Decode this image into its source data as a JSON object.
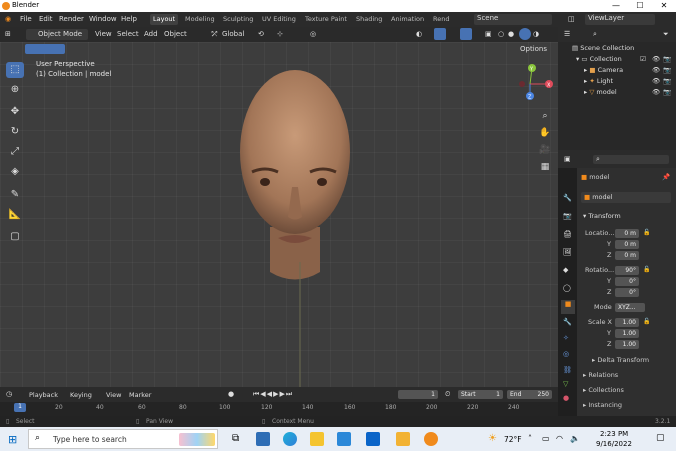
{
  "window": {
    "title": "Blender",
    "minimize": "—",
    "maximize": "☐",
    "close": "✕"
  },
  "menu": [
    "File",
    "Edit",
    "Render",
    "Window",
    "Help"
  ],
  "workspaces": [
    "Layout",
    "Modeling",
    "Sculpting",
    "UV Editing",
    "Texture Paint",
    "Shading",
    "Animation",
    "Rend"
  ],
  "scene": "Scene",
  "view_layer": "ViewLayer",
  "viewport": {
    "mode": "Object Mode",
    "menus": [
      "View",
      "Select",
      "Add",
      "Object"
    ],
    "orientation": "Global",
    "options": "Options",
    "overlay_title": "User Perspective",
    "overlay_sub": "(1) Collection | model",
    "gizmo": {
      "x": "X",
      "y": "Y",
      "z": "Z"
    }
  },
  "timeline": {
    "menus": [
      "Playback",
      "Keying",
      "View",
      "Marker"
    ],
    "current": "1",
    "start_label": "Start",
    "start": "1",
    "end_label": "End",
    "end": "250",
    "ticks": [
      "20",
      "40",
      "60",
      "80",
      "100",
      "120",
      "140",
      "160",
      "180",
      "200",
      "220",
      "240"
    ],
    "frame": "1"
  },
  "status": {
    "select": "Select",
    "pan": "Pan View",
    "context": "Context Menu",
    "version": "3.2.1"
  },
  "outliner": {
    "root": "Scene Collection",
    "items": [
      {
        "name": "Collection"
      },
      {
        "name": "Camera"
      },
      {
        "name": "Light"
      },
      {
        "name": "model"
      }
    ]
  },
  "properties": {
    "object": "model",
    "data": "model",
    "transform": "Transform",
    "location_label": "Locatio...",
    "loc": [
      "0 m",
      "0 m",
      "0 m"
    ],
    "rotation_label": "Rotatio...",
    "rot": [
      "90°",
      "0°",
      "0°"
    ],
    "mode_label": "Mode",
    "mode": "XYZ...",
    "scale_label": "Scale X",
    "scale": [
      "1.00",
      "1.00",
      "1.00"
    ],
    "axes": [
      "Y",
      "Z"
    ],
    "delta": "Delta Transform",
    "relations": "Relations",
    "collections": "Collections",
    "instancing": "Instancing"
  },
  "taskbar": {
    "search": "Type here to search",
    "weather": "72°F",
    "time": "2:23 PM",
    "date": "9/16/2022"
  }
}
